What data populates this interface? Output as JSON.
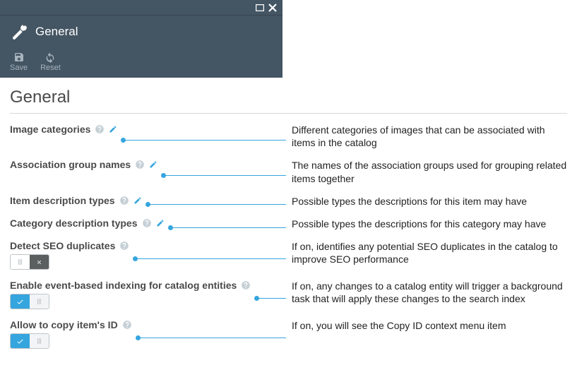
{
  "header": {
    "title": "General"
  },
  "toolbar": {
    "save_label": "Save",
    "reset_label": "Reset"
  },
  "heading": "General",
  "settings": [
    {
      "label": "Image categories",
      "has_edit": true,
      "type": "edit",
      "description": "Different categories of images that can be associated with items in the catalog"
    },
    {
      "label": "Association group names",
      "has_edit": true,
      "type": "edit",
      "description": "The names of the association groups used for grouping related items together"
    },
    {
      "label": "Item description types",
      "has_edit": true,
      "type": "edit",
      "description": "Possible types the descriptions for this item may have"
    },
    {
      "label": "Category description types",
      "has_edit": true,
      "type": "edit",
      "description": "Possible types the descriptions for this category may have"
    },
    {
      "label": "Detect SEO duplicates",
      "has_edit": false,
      "type": "toggle",
      "value": false,
      "description": "If on, identifies any potential SEO duplicates in the catalog to improve SEO performance"
    },
    {
      "label": "Enable event-based indexing for catalog entities",
      "has_edit": false,
      "type": "toggle",
      "value": true,
      "description": "If on, any changes to a catalog entity will trigger a background task that will apply these changes to the search index"
    },
    {
      "label": "Allow to copy item's ID",
      "has_edit": false,
      "type": "toggle",
      "value": true,
      "description": "If on, you will see the Copy ID context menu item"
    }
  ]
}
